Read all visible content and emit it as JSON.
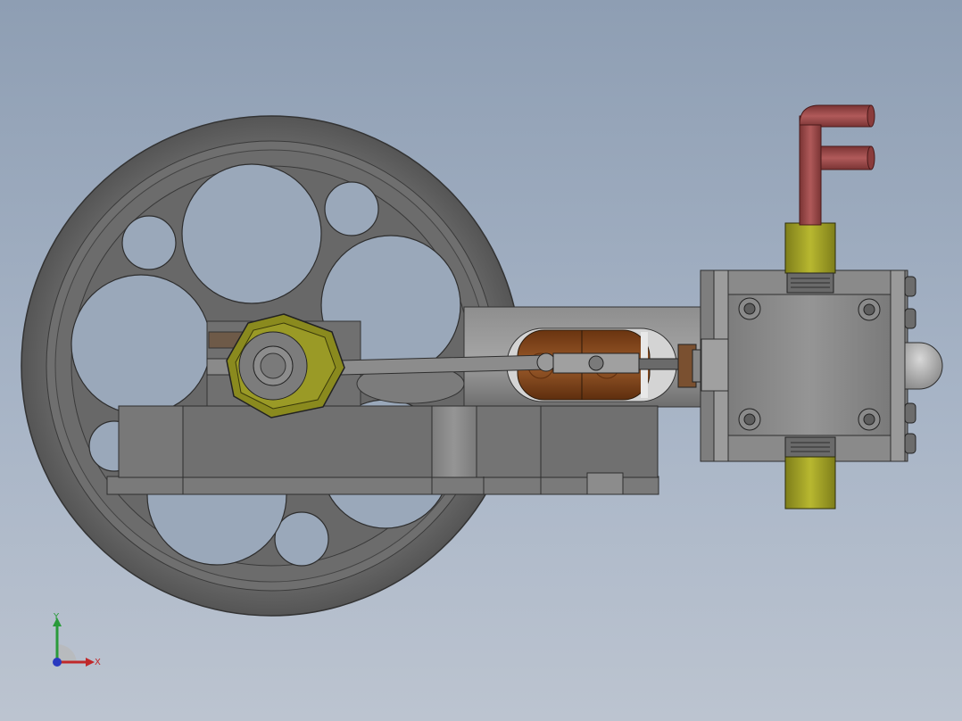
{
  "viewport": {
    "background_top": "#8e9eb3",
    "background_bottom": "#bcc4d0"
  },
  "model": {
    "parts": [
      {
        "name": "flywheel",
        "color": "#6f6f6f"
      },
      {
        "name": "engine-base",
        "color": "#737373"
      },
      {
        "name": "crank-nut",
        "color": "#8a8a1e"
      },
      {
        "name": "connecting-rod",
        "color": "#8c8c8c"
      },
      {
        "name": "crosshead-bearing",
        "color": "#7a4218"
      },
      {
        "name": "cylinder-block",
        "color": "#7a7a7a"
      },
      {
        "name": "brass-fitting",
        "color": "#a9a92a"
      },
      {
        "name": "steam-pipe",
        "color": "#9a4747"
      }
    ]
  },
  "triad": {
    "x_label": "X",
    "y_label": "Y",
    "x_color": "#c0282a",
    "y_color": "#2a9a3a",
    "z_color": "#2a3ac0"
  }
}
